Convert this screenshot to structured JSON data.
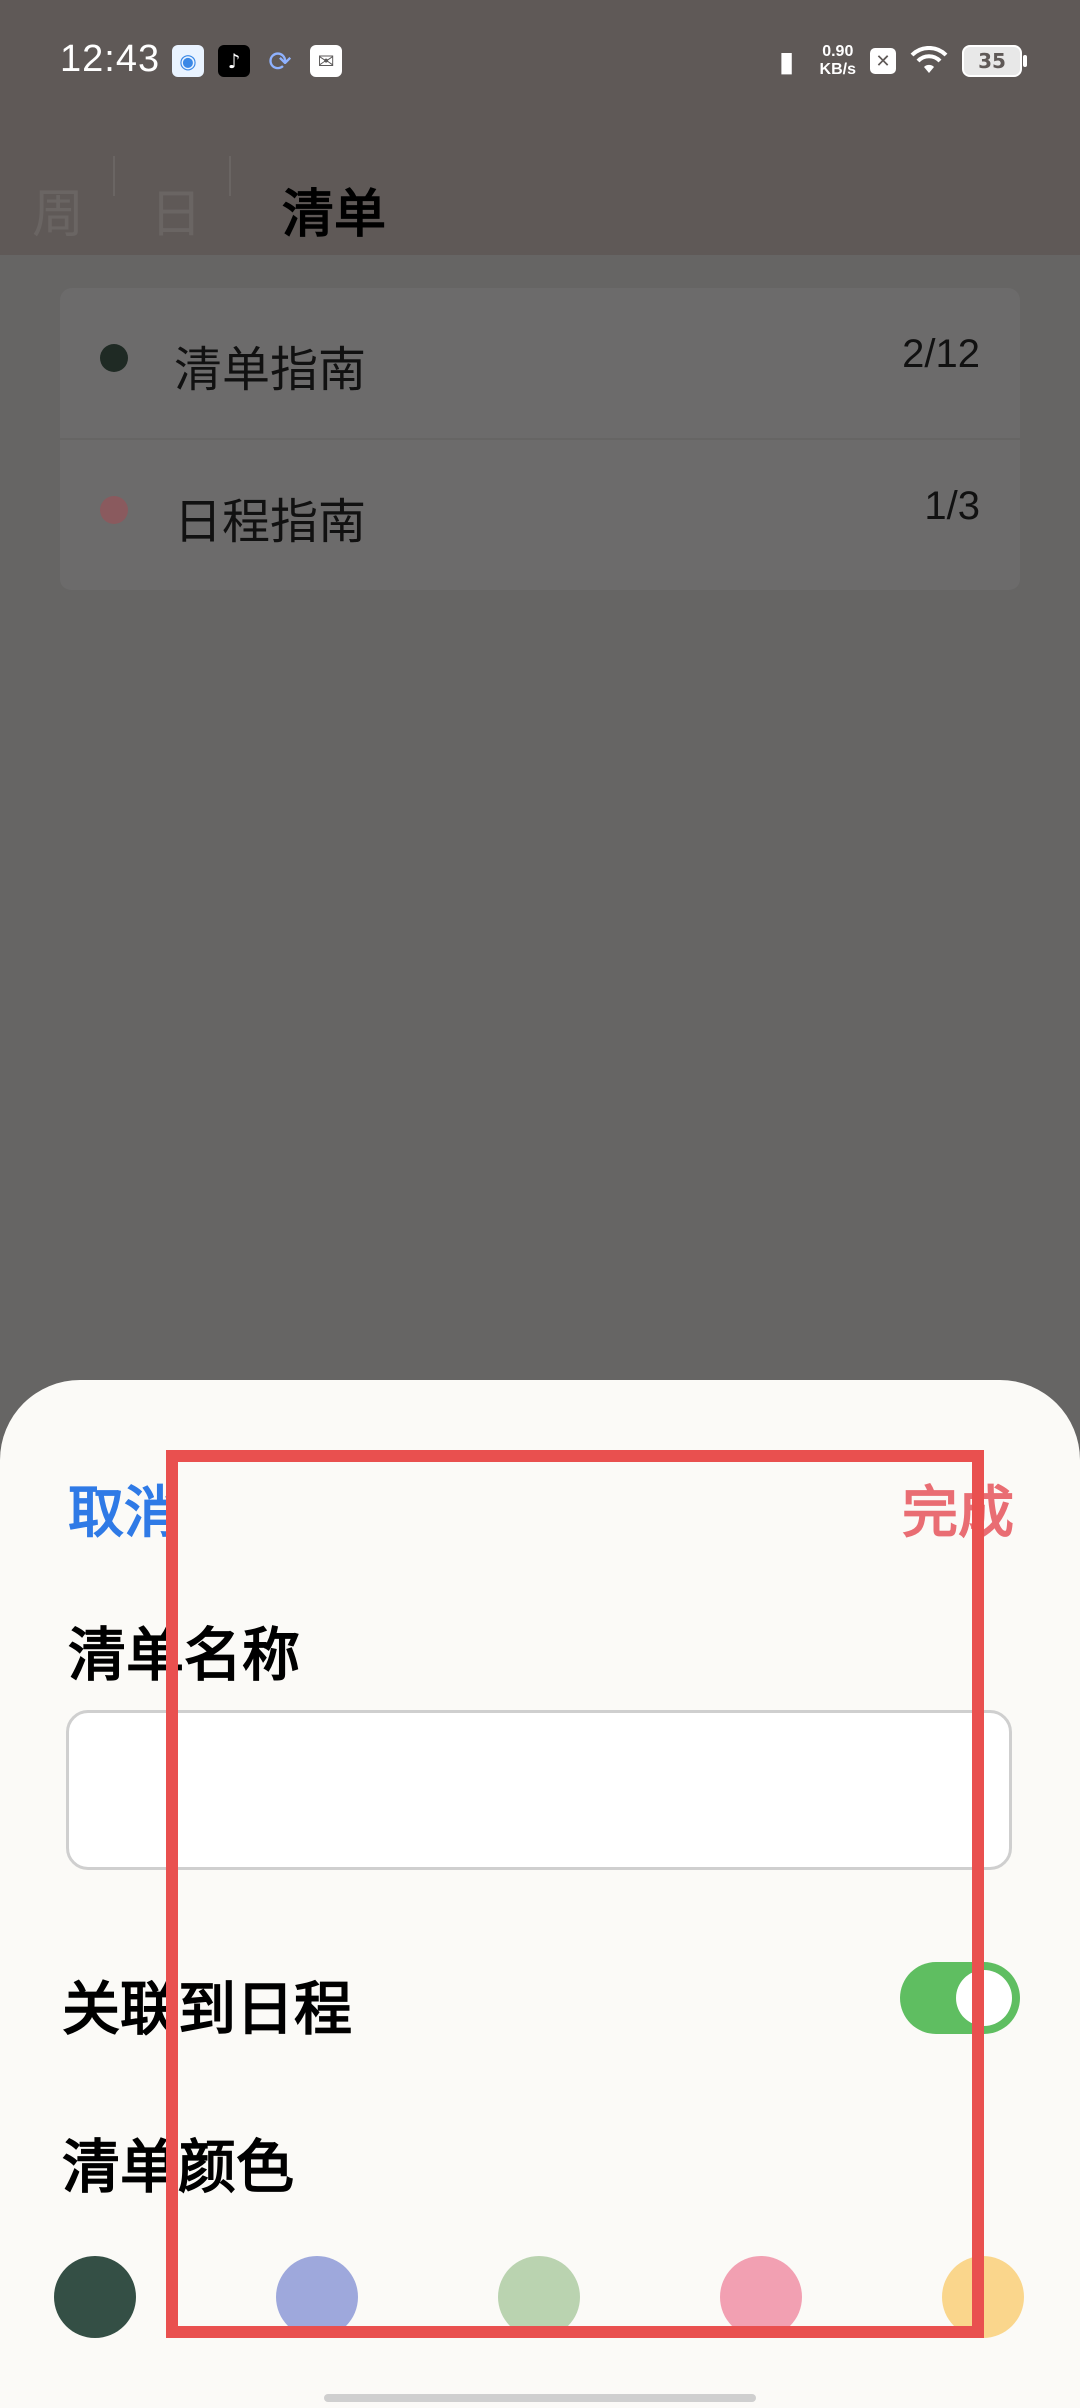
{
  "status_bar": {
    "time": "12:43",
    "net_speed_value": "0.90",
    "net_speed_unit": "KB/s",
    "battery": "35",
    "icons": [
      "browser-icon",
      "tiktok-icon",
      "download-icon",
      "mail-icon",
      "vibrate-icon",
      "x-icon",
      "wifi-icon",
      "battery-icon"
    ]
  },
  "header": {
    "tabs": [
      {
        "label": "周",
        "active": false
      },
      {
        "label": "日",
        "active": false
      },
      {
        "label": "清单",
        "active": true
      }
    ]
  },
  "lists": [
    {
      "title": "清单指南",
      "count": "2/12",
      "color": "#1f2a24"
    },
    {
      "title": "日程指南",
      "count": "1/3",
      "color": "#8a5a5e"
    }
  ],
  "sheet": {
    "cancel_label": "取消",
    "done_label": "完成",
    "name_label": "清单名称",
    "name_value": "",
    "link_label": "关联到日程",
    "link_enabled": true,
    "color_label": "清单颜色",
    "colors": [
      "#344f45",
      "#9ea8dc",
      "#bad3b0",
      "#f2a0b2",
      "#fad68c"
    ]
  },
  "colors": {
    "accent_blue": "#2f7ae6",
    "accent_red": "#e96d73",
    "toggle_green": "#5fbe61",
    "highlight_red": "#e9504f"
  }
}
